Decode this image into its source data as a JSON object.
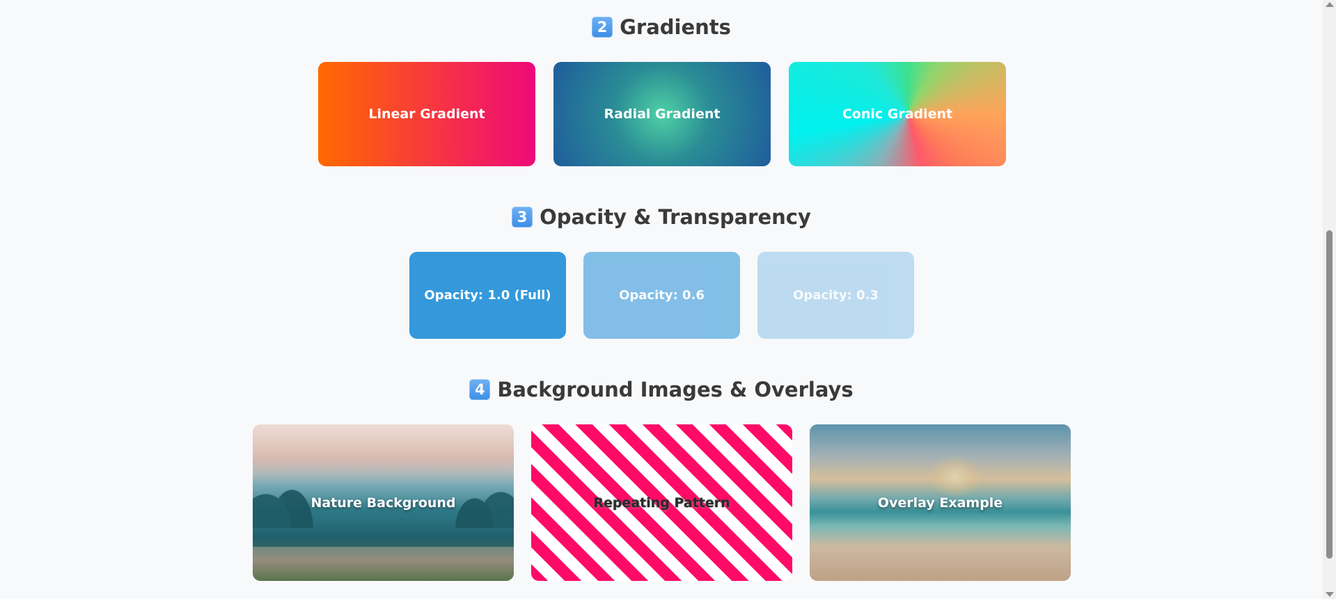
{
  "sections": {
    "gradients": {
      "number": "2",
      "title": "Gradients",
      "cards": [
        "Linear Gradient",
        "Radial Gradient",
        "Conic Gradient"
      ]
    },
    "opacity": {
      "number": "3",
      "title": "Opacity & Transparency",
      "cards": [
        {
          "label": "Opacity: 1.0 (Full)",
          "opacity": 1.0
        },
        {
          "label": "Opacity: 0.6",
          "opacity": 0.6
        },
        {
          "label": "Opacity: 0.3",
          "opacity": 0.3
        }
      ]
    },
    "backgrounds": {
      "number": "4",
      "title": "Background Images & Overlays",
      "cards": [
        "Nature Background",
        "Repeating Pattern",
        "Overlay Example"
      ]
    }
  },
  "colors": {
    "opacity_base": "#3498db",
    "stripe": "#ff0a67",
    "linear_start": "#ff6a00",
    "linear_end": "#ee0979"
  },
  "scrollbar": {
    "position": 0.55
  }
}
